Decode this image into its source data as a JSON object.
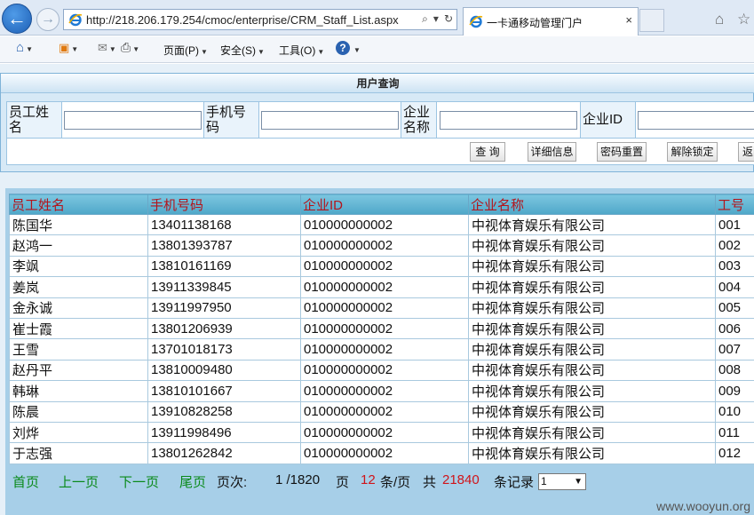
{
  "browser": {
    "url": "http://218.206.179.254/cmoc/enterprise/CRM_Staff_List.aspx",
    "tab_title": "一卡通移动管理门户",
    "tab_close": "×",
    "addr_tools": [
      "⌕",
      "▾",
      "↻"
    ],
    "back_glyph": "←",
    "forward_glyph": "→",
    "home_glyph": "⌂",
    "star_glyph": "☆"
  },
  "commandbar": {
    "home": "⌂",
    "feeds": "▣",
    "mail": "✉",
    "print": "⎙",
    "page": "页面(P)",
    "safety": "安全(S)",
    "tools": "工具(O)",
    "help": "?"
  },
  "query": {
    "title": "用户查询",
    "fields": [
      {
        "label": "员工姓名",
        "value": ""
      },
      {
        "label": "手机号码",
        "value": ""
      },
      {
        "label": "企业名称",
        "value": ""
      },
      {
        "label": "企业ID",
        "value": ""
      }
    ],
    "buttons": [
      "查 询",
      "详细信息",
      "密码重置",
      "解除锁定",
      "返回"
    ]
  },
  "grid": {
    "columns": [
      "员工姓名",
      "手机号码",
      "企业ID",
      "企业名称",
      "工号"
    ],
    "rows": [
      [
        "陈国华",
        "13401138168",
        "010000000002",
        "中视体育娱乐有限公司",
        "001"
      ],
      [
        "赵鸿一",
        "13801393787",
        "010000000002",
        "中视体育娱乐有限公司",
        "002"
      ],
      [
        "李飒",
        "13810161169",
        "010000000002",
        "中视体育娱乐有限公司",
        "003"
      ],
      [
        "姜岚",
        "13911339845",
        "010000000002",
        "中视体育娱乐有限公司",
        "004"
      ],
      [
        "金永诚",
        "13911997950",
        "010000000002",
        "中视体育娱乐有限公司",
        "005"
      ],
      [
        "崔士霞",
        "13801206939",
        "010000000002",
        "中视体育娱乐有限公司",
        "006"
      ],
      [
        "王雪",
        "13701018173",
        "010000000002",
        "中视体育娱乐有限公司",
        "007"
      ],
      [
        "赵丹平",
        "13810009480",
        "010000000002",
        "中视体育娱乐有限公司",
        "008"
      ],
      [
        "韩琳",
        "13810101667",
        "010000000002",
        "中视体育娱乐有限公司",
        "009"
      ],
      [
        "陈晨",
        "13910828258",
        "010000000002",
        "中视体育娱乐有限公司",
        "010"
      ],
      [
        "刘烨",
        "13911998496",
        "010000000002",
        "中视体育娱乐有限公司",
        "011"
      ],
      [
        "于志强",
        "13801262842",
        "010000000002",
        "中视体育娱乐有限公司",
        "012"
      ]
    ]
  },
  "pager": {
    "first": "首页",
    "prev": "上一页",
    "next": "下一页",
    "last": "尾页",
    "page_label": "页次:",
    "page_info": "1 /1820",
    "page_unit": "页",
    "per_page": "12",
    "per_page_unit": "条/页",
    "total_label": "共",
    "total": "21840",
    "total_unit": "条记录",
    "select_value": "1"
  },
  "watermark": "www.wooyun.org",
  "colors": {
    "header_text": "#b4141b",
    "pager_link": "#0a8a1a",
    "pager_number": "#d0141a"
  }
}
